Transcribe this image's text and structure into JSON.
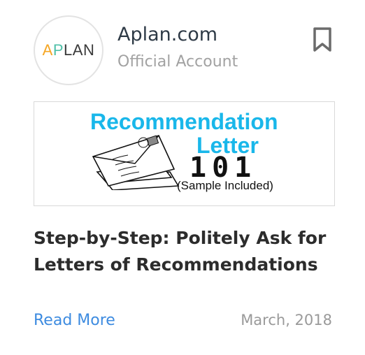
{
  "account": {
    "avatar_text": {
      "a": "A",
      "p": "P",
      "rest": "LAN"
    },
    "name": "Aplan.com",
    "subtitle": "Official Account"
  },
  "banner": {
    "title_line1": "Recommendation",
    "title_line2": "Letter",
    "number": "101",
    "note": "(Sample Included)"
  },
  "article": {
    "headline": "Step-by-Step: Politely Ask for Letters of Recommendations",
    "read_more": "Read More",
    "date": "March, 2018"
  },
  "icons": {
    "bookmark": "bookmark-icon",
    "envelope": "envelope-illustration"
  },
  "colors": {
    "accent_link": "#3d8be0",
    "banner_blue": "#19b7ea",
    "logo_orange": "#f5a623",
    "logo_teal": "#4fc0a8"
  }
}
